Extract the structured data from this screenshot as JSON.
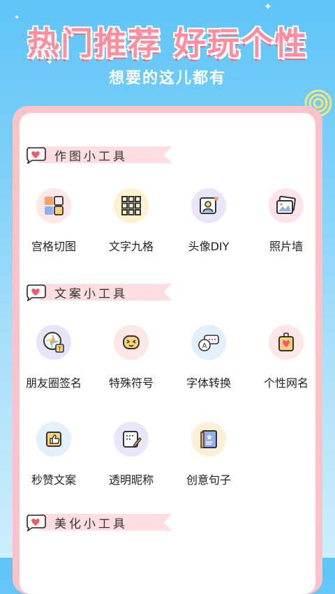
{
  "hero": {
    "title": "热门推荐 好玩个性",
    "subtitle": "想要的这儿都有"
  },
  "sections": [
    {
      "label": "作图小工具",
      "items": [
        {
          "label": "宫格切图",
          "icon": "grid-split-icon",
          "bg": "#fde7e7"
        },
        {
          "label": "文字九格",
          "icon": "nine-grid-text-icon",
          "bg": "#fdf2cf"
        },
        {
          "label": "头像DIY",
          "icon": "avatar-diy-icon",
          "bg": "#e9e6fb"
        },
        {
          "label": "照片墙",
          "icon": "photo-wall-icon",
          "bg": "#fde4ec"
        }
      ]
    },
    {
      "label": "文案小工具",
      "items": [
        {
          "label": "朋友圈签名",
          "icon": "moments-signature-icon",
          "bg": "#e6e4fb"
        },
        {
          "label": "特殊符号",
          "icon": "special-symbol-icon",
          "bg": "#fde6e6"
        },
        {
          "label": "字体转换",
          "icon": "font-convert-icon",
          "bg": "#e1f0fc"
        },
        {
          "label": "个性网名",
          "icon": "nickname-icon",
          "bg": "#fde6e6"
        },
        {
          "label": "秒赞文案",
          "icon": "like-copy-icon",
          "bg": "#e1f0fc"
        },
        {
          "label": "透明昵称",
          "icon": "transparent-name-icon",
          "bg": "#e9e6fb"
        },
        {
          "label": "创意句子",
          "icon": "creative-sentence-icon",
          "bg": "#fdf0d7"
        }
      ]
    },
    {
      "label": "美化小工具",
      "items": []
    }
  ]
}
